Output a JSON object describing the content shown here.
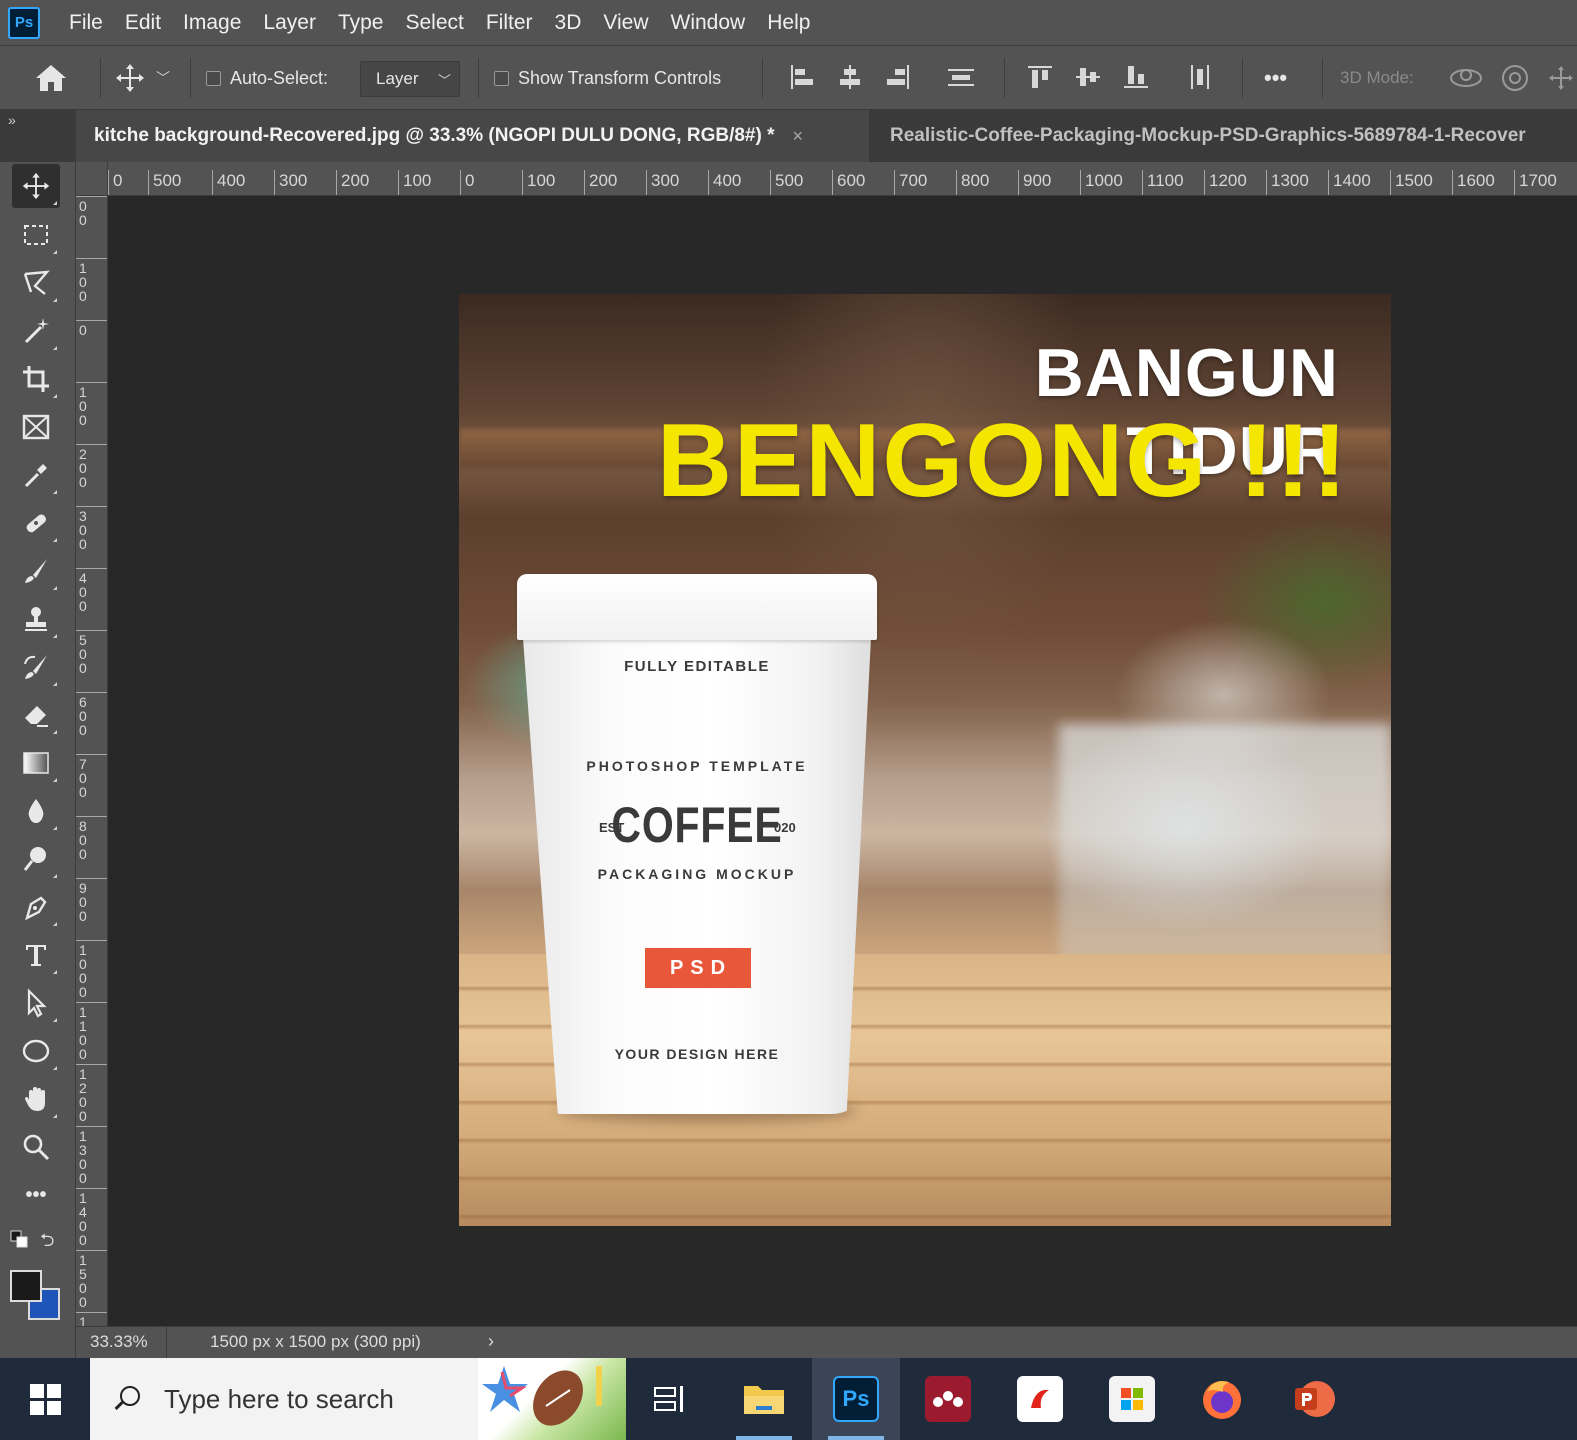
{
  "app": {
    "logo": "Ps"
  },
  "menubar": {
    "items": [
      "File",
      "Edit",
      "Image",
      "Layer",
      "Type",
      "Select",
      "Filter",
      "3D",
      "View",
      "Window",
      "Help"
    ]
  },
  "options": {
    "home_icon": "home-icon",
    "move_icon": "move-icon",
    "auto_select_label": "Auto-Select:",
    "auto_select_checked": false,
    "layer_select_value": "Layer",
    "show_transform_label": "Show Transform Controls",
    "show_transform_checked": false,
    "mode_3d_label": "3D Mode:",
    "more_label": "•••"
  },
  "tabs": [
    {
      "label": "kitche background-Recovered.jpg @ 33.3% (NGOPI DULU DONG, RGB/8#) *",
      "close": "×",
      "active": true
    },
    {
      "label": "Realistic-Coffee-Packaging-Mockup-PSD-Graphics-5689784-1-Recover",
      "active": false
    }
  ],
  "ruler": {
    "horizontal": [
      "0",
      "500",
      "400",
      "300",
      "200",
      "100",
      "0",
      "100",
      "200",
      "300",
      "400",
      "500",
      "600",
      "700",
      "800",
      "900",
      "1000",
      "1100",
      "1200",
      "1300",
      "1400",
      "1500",
      "1600",
      "1700"
    ],
    "vertical": [
      "00",
      "100",
      "0",
      "100",
      "200",
      "300",
      "400",
      "500",
      "600",
      "700",
      "800",
      "900",
      "1000",
      "1100",
      "1200",
      "1300",
      "1400",
      "1500",
      "1600"
    ]
  },
  "toolbar": {
    "tools": [
      "move-tool",
      "rectangular-marquee-tool",
      "lasso-tool",
      "magic-wand-tool",
      "crop-tool",
      "frame-tool",
      "eyedropper-tool",
      "healing-brush-tool",
      "brush-tool",
      "clone-stamp-tool",
      "history-brush-tool",
      "eraser-tool",
      "gradient-tool",
      "blur-tool",
      "dodge-tool",
      "pen-tool",
      "type-tool",
      "path-selection-tool",
      "ellipse-tool",
      "hand-tool",
      "zoom-tool",
      "more-tools"
    ],
    "foreground_color": "#1a1a1a",
    "background_color": "#1f55b8"
  },
  "artwork": {
    "headline_1": "BANGUN TIDUR",
    "headline_2": "BENGONG !!!",
    "headline_2_color": "#f5e600",
    "pouch": {
      "fully_editable": "FULLY EDITABLE",
      "template": "PHOTOSHOP TEMPLATE",
      "coffee": "COFFEE",
      "est": "EST",
      "year": "020",
      "packaging": "PACKAGING MOCKUP",
      "psd": "PSD",
      "psd_color": "#e9573a",
      "design": "YOUR DESIGN HERE"
    }
  },
  "status": {
    "zoom": "33.33%",
    "doc_size": "1500 px x 1500 px (300 ppi)",
    "arrow": "›"
  },
  "taskbar": {
    "search_placeholder": "Type here to search",
    "apps": [
      "task-view",
      "file-explorer",
      "photoshop",
      "mendeley",
      "foxit-reader",
      "microsoft-store",
      "firefox",
      "powerpoint"
    ]
  }
}
